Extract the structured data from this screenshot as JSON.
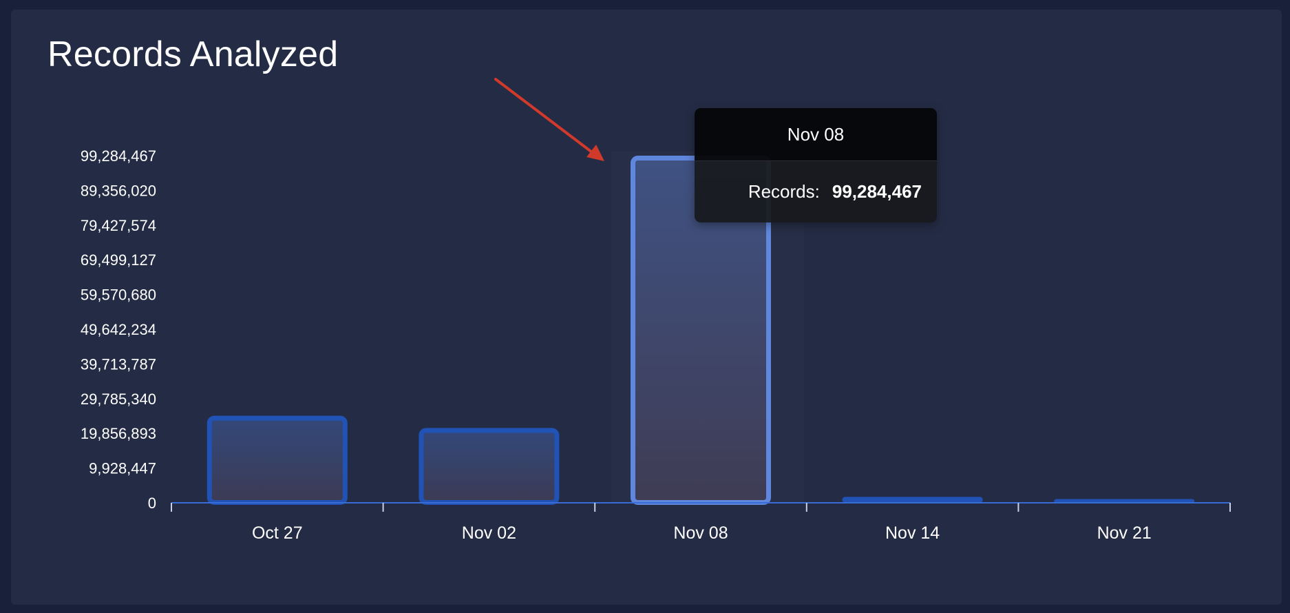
{
  "panel": {
    "title": "Records Analyzed"
  },
  "chart_data": {
    "type": "bar",
    "title": "Records Analyzed",
    "xlabel": "",
    "ylabel": "",
    "categories": [
      "Oct 27",
      "Nov 02",
      "Nov 08",
      "Nov 14",
      "Nov 21"
    ],
    "values": [
      24900000,
      21400000,
      99284467,
      1300000,
      700000
    ],
    "yticks": [
      "0",
      "9,928,447",
      "19,856,893",
      "29,785,340",
      "39,713,787",
      "49,642,234",
      "59,570,680",
      "69,499,127",
      "79,427,574",
      "89,356,020",
      "99,284,467"
    ],
    "ylim": [
      0,
      99284467
    ],
    "highlighted_category": "Nov 08",
    "colors": {
      "bar": "#2152b5",
      "bar_highlight": "#5f87dd",
      "axis": "#3a6cd8",
      "text": "#ffffff"
    },
    "grid": false,
    "legend": "none"
  },
  "tooltip": {
    "header": "Nov 08",
    "label": "Records:",
    "value": "99,284,467"
  },
  "annotation": {
    "type": "arrow",
    "color": "#d13a2a"
  }
}
